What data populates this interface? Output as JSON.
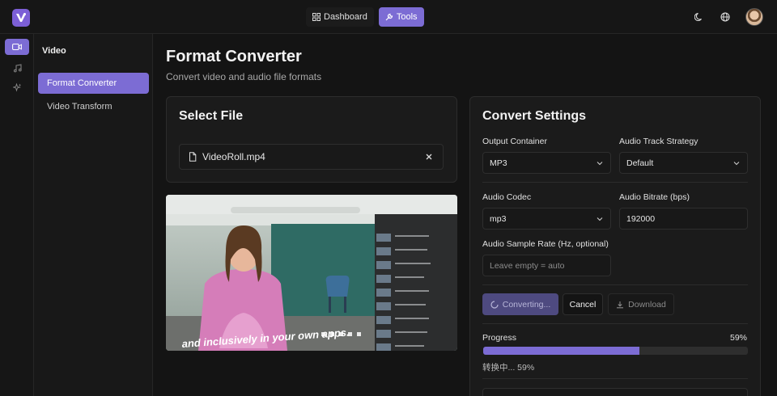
{
  "app": {
    "logo_letter": "V"
  },
  "topnav": {
    "dashboard_label": "Dashboard",
    "tools_label": "Tools"
  },
  "sidebar": {
    "section_title": "Video",
    "items": [
      {
        "label": "Format Converter",
        "active": true
      },
      {
        "label": "Video Transform",
        "active": false
      }
    ]
  },
  "page": {
    "title": "Format Converter",
    "subtitle": "Convert video and audio file formats"
  },
  "select_file": {
    "title": "Select File",
    "file_name": "VideoRoll.mp4"
  },
  "video_preview": {
    "caption": "and inclusively in your own apps."
  },
  "settings": {
    "title": "Convert Settings",
    "output_container": {
      "label": "Output Container",
      "value": "MP3"
    },
    "audio_track_strategy": {
      "label": "Audio Track Strategy",
      "value": "Default"
    },
    "audio_codec": {
      "label": "Audio Codec",
      "value": "mp3"
    },
    "audio_bitrate": {
      "label": "Audio Bitrate (bps)",
      "value": "192000"
    },
    "sample_rate": {
      "label": "Audio Sample Rate (Hz, optional)",
      "placeholder": "Leave empty = auto"
    },
    "buttons": {
      "converting": "Converting...",
      "cancel": "Cancel",
      "download": "Download"
    },
    "progress": {
      "label": "Progress",
      "percent_text": "59%",
      "value": 0.59,
      "status": "转换中... 59%"
    }
  },
  "colors": {
    "accent": "#7c6cd4",
    "background": "#141414",
    "card": "#1b1b1b"
  }
}
